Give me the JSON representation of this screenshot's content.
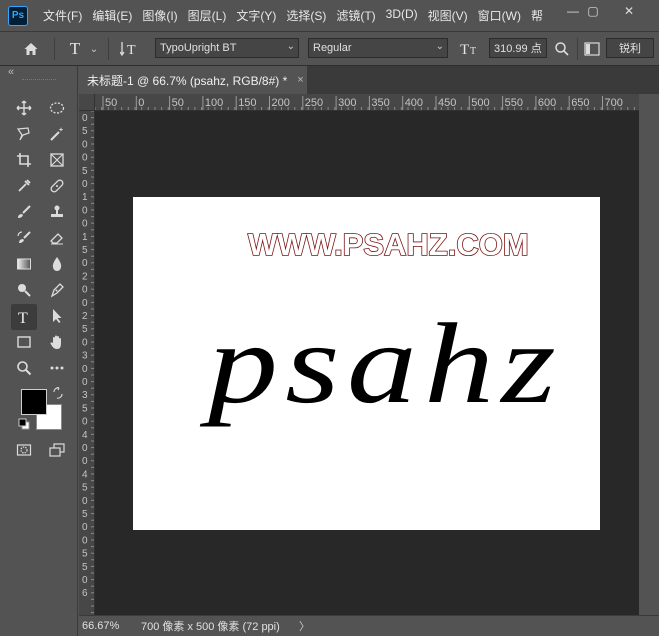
{
  "app": {
    "logo_text": "Ps"
  },
  "menu": [
    "文件(F)",
    "编辑(E)",
    "图像(I)",
    "图层(L)",
    "文字(Y)",
    "选择(S)",
    "滤镜(T)",
    "3D(D)",
    "视图(V)",
    "窗口(W)",
    "帮"
  ],
  "window_controls": {
    "minimize": "—",
    "restore": "▢",
    "close": "✕"
  },
  "options": {
    "font_family": "TypoUpright BT",
    "font_style": "Regular",
    "font_size": "310.99 点",
    "antialias": "锐利",
    "type_icon": "T",
    "chevron": "⌄"
  },
  "document": {
    "tab_title": "未标题-1 @ 66.7% (psahz, RGB/8#) *",
    "close": "×",
    "watermark": "WWW.PSAHZ.COM",
    "text_layer": "psahz"
  },
  "ruler_h": [
    "50",
    "0",
    "50",
    "100",
    "150",
    "200",
    "250",
    "300",
    "350",
    "400",
    "450",
    "500",
    "550",
    "600",
    "650",
    "700"
  ],
  "ruler_v": [
    "0",
    "5",
    "0",
    "0",
    "5",
    "0",
    "1",
    "0",
    "0",
    "1",
    "5",
    "0",
    "2",
    "0",
    "0",
    "2",
    "5",
    "0",
    "3",
    "0",
    "0",
    "3",
    "5",
    "0",
    "4",
    "0",
    "0",
    "4",
    "5",
    "0",
    "5",
    "0",
    "0",
    "5",
    "5",
    "0",
    "6"
  ],
  "status": {
    "zoom": "66.67%",
    "info": "700 像素 x 500 像素 (72 ppi)",
    "arrow": "〉"
  },
  "toolbar": {
    "collapse": "«"
  },
  "colors": {
    "foreground": "#000000",
    "background": "#ffffff",
    "watermark_fill": "#ffffff",
    "watermark_stroke": "#7a1010",
    "accent": "#31a8ff"
  }
}
